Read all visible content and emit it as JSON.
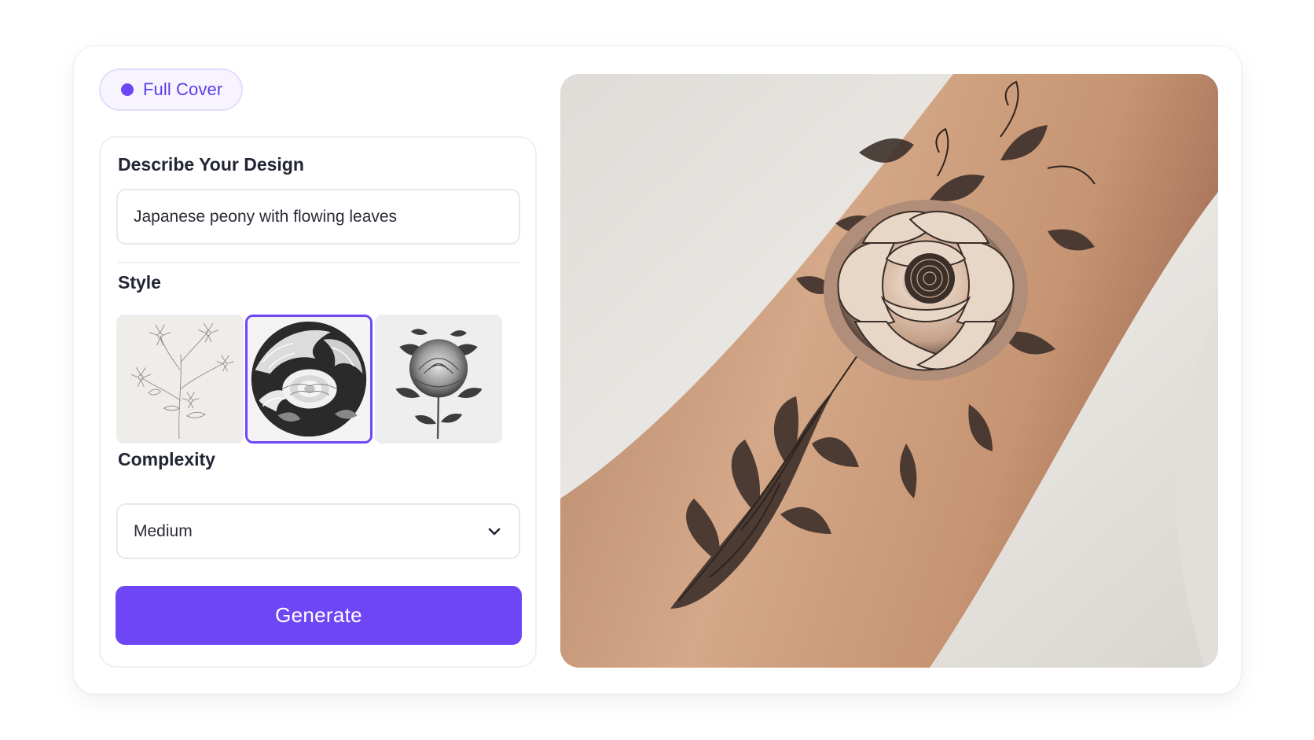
{
  "mode_chip": {
    "label": "Full Cover",
    "dot_color": "#6e46f5"
  },
  "design": {
    "title": "Describe Your Design",
    "input_value": "Japanese peony with flowing leaves"
  },
  "style": {
    "title": "Style",
    "options": [
      {
        "name": "Fine line floral sketch",
        "selected": false
      },
      {
        "name": "Japanese wave peony",
        "selected": true
      },
      {
        "name": "Realistic black & grey rose",
        "selected": false
      }
    ]
  },
  "complexity": {
    "title": "Complexity",
    "selected": "Medium"
  },
  "generate": {
    "label": "Generate"
  },
  "preview": {
    "subject": "Black and grey peony tattoo on forearm"
  },
  "colors": {
    "accent": "#6e46f5",
    "chip_bg": "#f7f4ff",
    "skin": "#c89a77"
  }
}
